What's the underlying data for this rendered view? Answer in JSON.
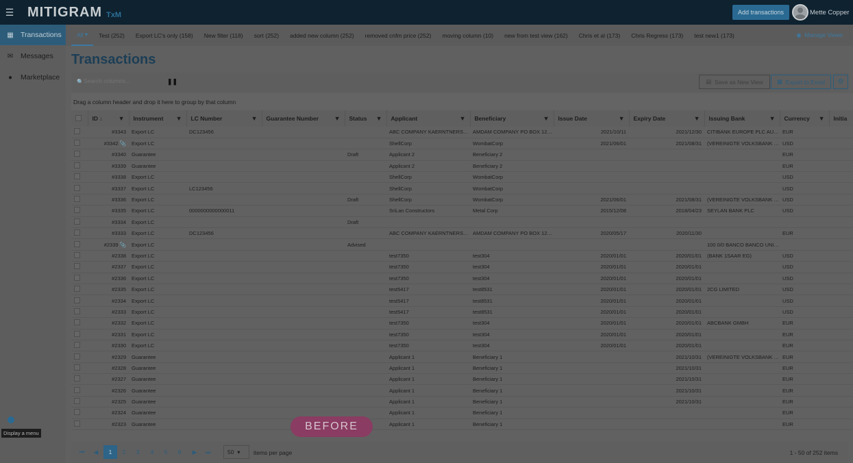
{
  "header": {
    "logo": "MITIGRAM",
    "logo_sub": "TxM",
    "add_button": "Add transactions",
    "user_name": "Mette Copper"
  },
  "sidebar": {
    "items": [
      {
        "label": "Transactions",
        "icon": "grid-icon"
      },
      {
        "label": "Messages",
        "icon": "envelope-icon"
      },
      {
        "label": "Marketplace",
        "icon": "globe-icon"
      }
    ],
    "tooltip": "Display a menu"
  },
  "tabs": {
    "items": [
      "All",
      "Test (252)",
      "Export LC's only (158)",
      "New filter (118)",
      "sort (252)",
      "added new column (252)",
      "removed cnfm price (252)",
      "moving column (10)",
      "new from test view (162)",
      "Chris et al (173)",
      "Chris Regress (173)",
      "test new1 (173)"
    ],
    "manage": "Manage Views"
  },
  "page": {
    "title": "Transactions"
  },
  "toolbar": {
    "search_placeholder": "Search columns...",
    "save_view": "Save as New View",
    "export": "Export to Excel"
  },
  "grid": {
    "group_hint": "Drag a column header and drop it here to group by that column",
    "columns": [
      "ID",
      "Instrument",
      "LC Number",
      "Guarantee Number",
      "Status",
      "Applicant",
      "Beneficiary",
      "Issue Date",
      "Expiry Date",
      "Issuing Bank",
      "Currency",
      "Initia"
    ],
    "rows": [
      [
        "#3343",
        "Export LC",
        "DC123456",
        "",
        "",
        "ABC COMPANY KAERNTNERSTRASSE",
        "AMDAM COMPANY PO BOX 12345",
        "2021/10/11",
        "2021/12/30",
        "CITIBANK EUROPE PLC AUSTRIA",
        "EUR"
      ],
      [
        "#3342",
        "Export LC",
        "",
        "",
        "",
        "ShellCorp",
        "WombatCorp",
        "2021/06/01",
        "2021/08/31",
        "(VEREINIGTE VOLKSBANK EG)",
        "USD"
      ],
      [
        "#3340",
        "Guarantee",
        "",
        "",
        "Draft",
        "Applicant 2",
        "Beneficiary 2",
        "",
        "",
        "",
        "EUR"
      ],
      [
        "#3339",
        "Guarantee",
        "",
        "",
        "",
        "Applicant 2",
        "Beneficiary 2",
        "",
        "",
        "",
        "EUR"
      ],
      [
        "#3338",
        "Export LC",
        "",
        "",
        "",
        "ShellCorp",
        "WombatCorp",
        "",
        "",
        "",
        "USD"
      ],
      [
        "#3337",
        "Export LC",
        "LC123456",
        "",
        "",
        "ShellCorp",
        "WombatCorp",
        "",
        "",
        "",
        "USD"
      ],
      [
        "#3336",
        "Export LC",
        "",
        "",
        "Draft",
        "ShellCorp",
        "WombatCorp",
        "2021/06/01",
        "2021/08/31",
        "(VEREINIGTE VOLKSBANK EG)",
        "USD"
      ],
      [
        "#3335",
        "Export LC",
        "0000000000000011",
        "",
        "",
        "SriLan Constructors",
        "Metal Corp",
        "2015/12/08",
        "2018/04/23",
        "SEYLAN BANK PLC",
        "USD"
      ],
      [
        "#3334",
        "Export LC",
        "",
        "",
        "Draft",
        "",
        "",
        "",
        "",
        "",
        ""
      ],
      [
        "#3333",
        "Export LC",
        "DC123456",
        "",
        "",
        "ABC COMPANY KAERNTNERSTRASSE",
        "AMDAM COMPANY PO BOX 12345",
        "2020/05/17",
        "2020/11/30",
        "",
        "EUR"
      ],
      [
        "#2339",
        "Export LC",
        "",
        "",
        "Advised",
        "",
        "",
        "",
        "",
        "100 0/0 BANCO BANCO UNICO",
        ""
      ],
      [
        "#2338",
        "Export LC",
        "",
        "",
        "",
        "test7350",
        "test304",
        "2020/01/01",
        "2020/01/01",
        "(BANK 1SAAR EG)",
        "USD"
      ],
      [
        "#2337",
        "Export LC",
        "",
        "",
        "",
        "test7350",
        "test304",
        "2020/01/01",
        "2020/01/01",
        "",
        "USD"
      ],
      [
        "#2336",
        "Export LC",
        "",
        "",
        "",
        "test7350",
        "test304",
        "2020/01/01",
        "2020/01/01",
        "",
        "USD"
      ],
      [
        "#2335",
        "Export LC",
        "",
        "",
        "",
        "test5417",
        "test8531",
        "2020/01/01",
        "2020/01/01",
        "2CG LIMITED",
        "USD"
      ],
      [
        "#2334",
        "Export LC",
        "",
        "",
        "",
        "test5417",
        "test8531",
        "2020/01/01",
        "2020/01/01",
        "",
        "USD"
      ],
      [
        "#2333",
        "Export LC",
        "",
        "",
        "",
        "test5417",
        "test8531",
        "2020/01/01",
        "2020/01/01",
        "",
        "USD"
      ],
      [
        "#2332",
        "Export LC",
        "",
        "",
        "",
        "test7350",
        "test304",
        "2020/01/01",
        "2020/01/01",
        "ABCBANK GMBH",
        "EUR"
      ],
      [
        "#2331",
        "Export LC",
        "",
        "",
        "",
        "test7350",
        "test304",
        "2020/01/01",
        "2020/01/01",
        "",
        "EUR"
      ],
      [
        "#2330",
        "Export LC",
        "",
        "",
        "",
        "test7350",
        "test304",
        "2020/01/01",
        "2020/01/01",
        "",
        "EUR"
      ],
      [
        "#2329",
        "Guarantee",
        "",
        "",
        "",
        "Applicant 1",
        "Beneficiary 1",
        "",
        "2021/10/31",
        "(VEREINIGTE VOLKSBANK EG)",
        "EUR"
      ],
      [
        "#2328",
        "Guarantee",
        "",
        "",
        "",
        "Applicant 1",
        "Beneficiary 1",
        "",
        "2021/10/31",
        "",
        "EUR"
      ],
      [
        "#2327",
        "Guarantee",
        "",
        "",
        "",
        "Applicant 1",
        "Beneficiary 1",
        "",
        "2021/10/31",
        "",
        "EUR"
      ],
      [
        "#2326",
        "Guarantee",
        "",
        "",
        "",
        "Applicant 1",
        "Beneficiary 1",
        "",
        "2021/10/31",
        "",
        "EUR"
      ],
      [
        "#2325",
        "Guarantee",
        "",
        "",
        "",
        "Applicant 1",
        "Beneficiary 1",
        "",
        "2021/10/31",
        "",
        "EUR"
      ],
      [
        "#2324",
        "Guarantee",
        "",
        "",
        "",
        "Applicant 1",
        "Beneficiary 1",
        "",
        "",
        "",
        "EUR"
      ],
      [
        "#2323",
        "Guarantee",
        "",
        "",
        "",
        "Applicant 1",
        "Beneficiary 1",
        "",
        "",
        "",
        "EUR"
      ]
    ],
    "attachment_rows": [
      "#3342",
      "#2339"
    ]
  },
  "pagination": {
    "pages": [
      "1",
      "2",
      "3",
      "4",
      "5",
      "6"
    ],
    "per_page": "50",
    "per_page_label": "items per page",
    "range": "1 - 50 of 252 items"
  },
  "overlay": {
    "label": "BEFORE"
  },
  "colors": {
    "accent": "#3b7aa3",
    "topbar": "#0e2230",
    "badge": "#8a3c62"
  }
}
